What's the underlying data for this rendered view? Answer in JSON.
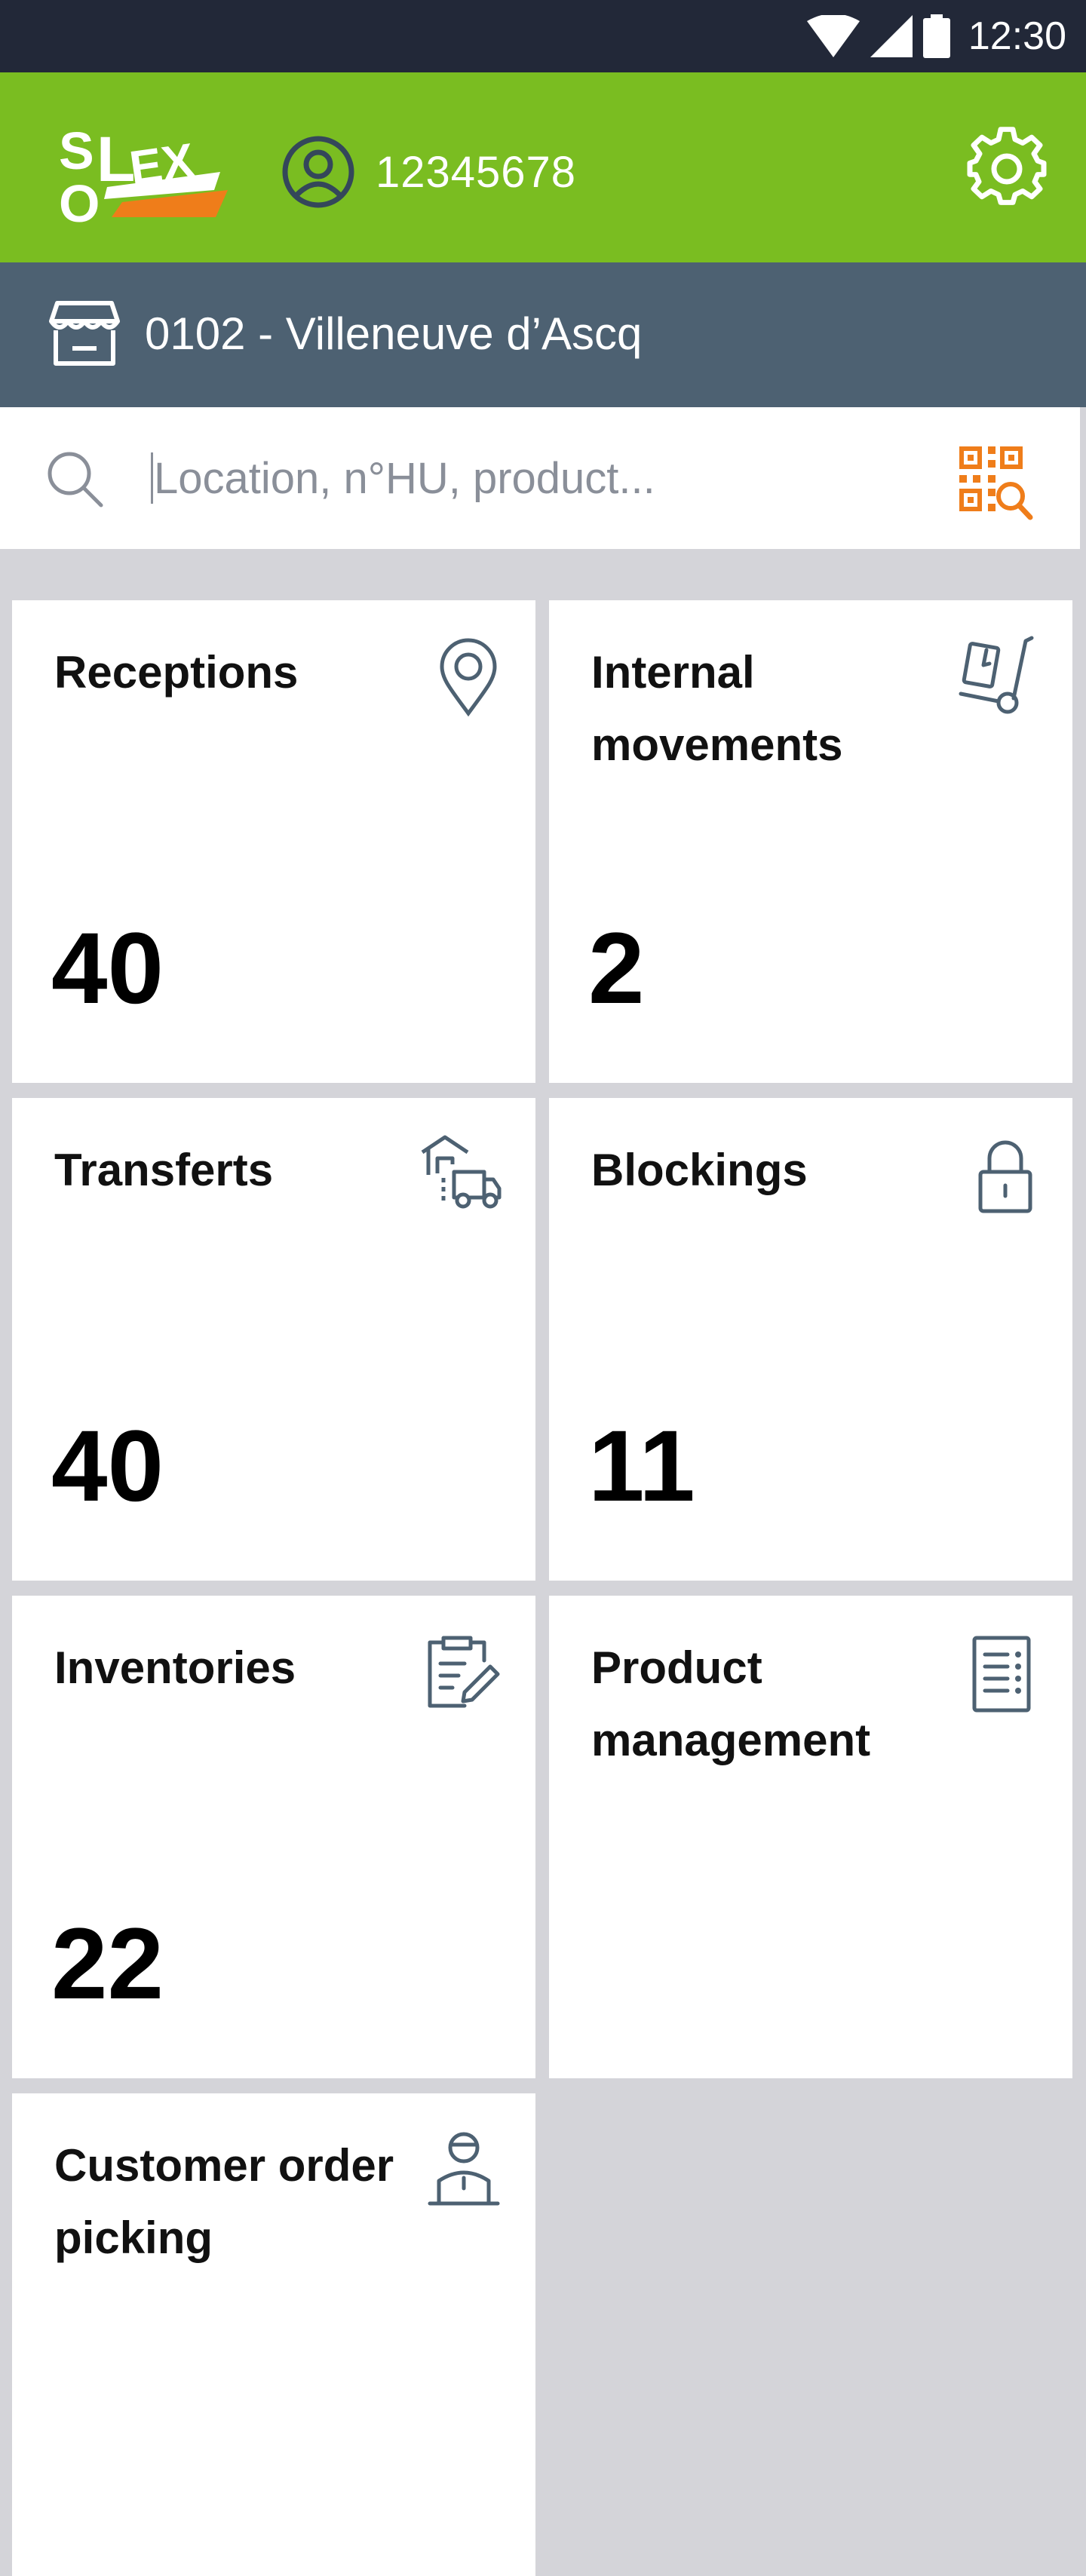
{
  "status_bar": {
    "time": "12:30"
  },
  "header": {
    "logo_text": "SOLEX",
    "user_id": "12345678"
  },
  "store": {
    "label": "0102 - Villeneuve d’Ascq"
  },
  "search": {
    "placeholder": "Location, n°HU, product..."
  },
  "tiles": [
    {
      "title": "Receptions",
      "count": "40",
      "icon": "location-pin-icon"
    },
    {
      "title": "Internal movements",
      "count": "2",
      "icon": "hand-truck-icon"
    },
    {
      "title": "Transferts",
      "count": "40",
      "icon": "warehouse-truck-icon"
    },
    {
      "title": "Blockings",
      "count": "11",
      "icon": "padlock-icon"
    },
    {
      "title": "Inventories",
      "count": "22",
      "icon": "clipboard-edit-icon"
    },
    {
      "title": "Product management",
      "count": "",
      "icon": "product-list-icon"
    },
    {
      "title": "Customer order picking",
      "count": "",
      "icon": "person-counter-icon"
    }
  ],
  "colors": {
    "header_green": "#7abd21",
    "store_bar": "#4d6172",
    "status_bar": "#222838",
    "accent_orange": "#ef7d1a",
    "background": "#d4d4d9"
  }
}
